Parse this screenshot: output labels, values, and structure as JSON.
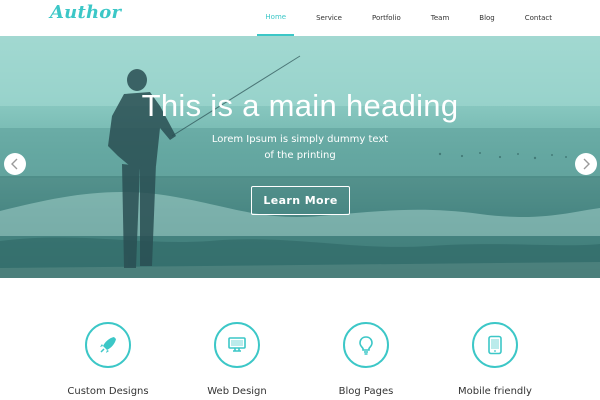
{
  "brand": {
    "name": "Author"
  },
  "nav": {
    "items": [
      {
        "label": "Home",
        "active": true
      },
      {
        "label": "Service",
        "active": false
      },
      {
        "label": "Portfolio",
        "active": false
      },
      {
        "label": "Team",
        "active": false
      },
      {
        "label": "Blog",
        "active": false
      },
      {
        "label": "Contact",
        "active": false
      }
    ]
  },
  "hero": {
    "title": "This is a main heading",
    "subtitle_line1": "Lorem Ipsum is simply dummy text",
    "subtitle_line2": "of the printing",
    "button_label": "Learn More",
    "prev_icon": "chevron-left-icon",
    "next_icon": "chevron-right-icon"
  },
  "features": [
    {
      "label": "Custom Designs",
      "icon": "rocket-icon"
    },
    {
      "label": "Web Design",
      "icon": "monitor-icon"
    },
    {
      "label": "Blog Pages",
      "icon": "lightbulb-icon"
    },
    {
      "label": "Mobile friendly",
      "icon": "tablet-icon"
    }
  ],
  "colors": {
    "accent": "#3cc7c7",
    "hero_overlay": "#7ec8c0",
    "text_dark": "#333333"
  }
}
